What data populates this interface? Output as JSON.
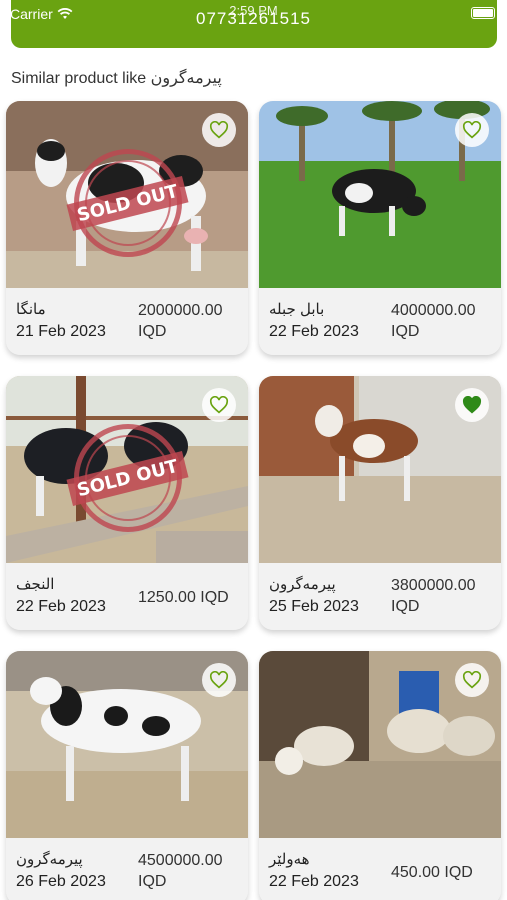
{
  "status_bar": {
    "carrier": "Carrier",
    "time": "2:59 PM"
  },
  "header": {
    "phone": "07731261515",
    "accent": "#6aa311"
  },
  "section": {
    "title": "Similar product like پیرمەگرون"
  },
  "sold_label": "SOLD OUT",
  "products": [
    {
      "name": "مانگا",
      "date": "21 Feb 2023",
      "price": "2000000.00 IQD",
      "sold": true,
      "favorite": false
    },
    {
      "name": "بابل جبله",
      "date": "22 Feb 2023",
      "price": "4000000.00 IQD",
      "sold": false,
      "favorite": false
    },
    {
      "name": "النجف",
      "date": "22 Feb 2023",
      "price": "1250.00 IQD",
      "sold": true,
      "favorite": false
    },
    {
      "name": "پیرمەگرون",
      "date": "25 Feb 2023",
      "price": "3800000.00 IQD",
      "sold": false,
      "favorite": true
    },
    {
      "name": "پیرمەگرون",
      "date": "26 Feb 2023",
      "price": "4500000.00 IQD",
      "sold": false,
      "favorite": false
    },
    {
      "name": "هەولێر",
      "date": "22 Feb 2023",
      "price": "450.00 IQD",
      "sold": false,
      "favorite": false
    }
  ]
}
